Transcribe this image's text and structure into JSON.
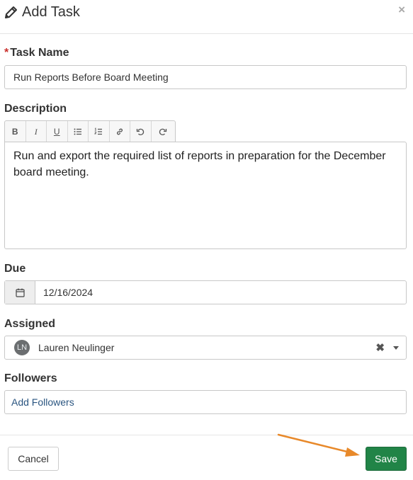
{
  "dialog": {
    "title": "Add Task",
    "close_label": "×"
  },
  "form": {
    "task_name": {
      "required_marker": "*",
      "label": "Task Name",
      "value": "Run Reports Before Board Meeting"
    },
    "description": {
      "label": "Description",
      "toolbar": [
        "bold-icon",
        "italic-icon",
        "underline-icon",
        "bullet-list-icon",
        "numbered-list-icon",
        "link-icon",
        "undo-icon",
        "redo-icon"
      ],
      "value": "Run and export the required list of reports in preparation for the December board meeting."
    },
    "due": {
      "label": "Due",
      "value": "12/16/2024",
      "icon": "calendar-icon"
    },
    "assigned": {
      "label": "Assigned",
      "avatar_initials": "LN",
      "value": "Lauren Neulinger",
      "clear_label": "✖"
    },
    "followers": {
      "label": "Followers",
      "placeholder": "Add Followers"
    }
  },
  "footer": {
    "cancel_label": "Cancel",
    "save_label": "Save"
  },
  "annotation": {
    "color": "#e8892a",
    "target": "save-button"
  }
}
